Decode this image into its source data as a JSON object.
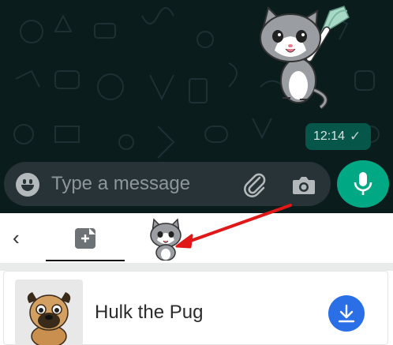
{
  "chat": {
    "message_time": "12:14",
    "read_tick": "✓"
  },
  "input": {
    "placeholder": "Type a message"
  },
  "sticker_panel": {
    "back_glyph": "‹",
    "pack": {
      "name": "Hulk the Pug"
    }
  },
  "icons": {
    "emoji": "emoji-icon",
    "attach": "paperclip-icon",
    "camera": "camera-icon",
    "mic": "mic-icon",
    "new_sticker": "add-sticker-icon",
    "download": "download-icon"
  },
  "colors": {
    "chat_bg": "#0b1c1d",
    "bubble": "#06574a",
    "input_bar": "#283338",
    "mic_button": "#00a884",
    "download_button": "#2a6fe6",
    "annotation_arrow": "#e01818"
  }
}
